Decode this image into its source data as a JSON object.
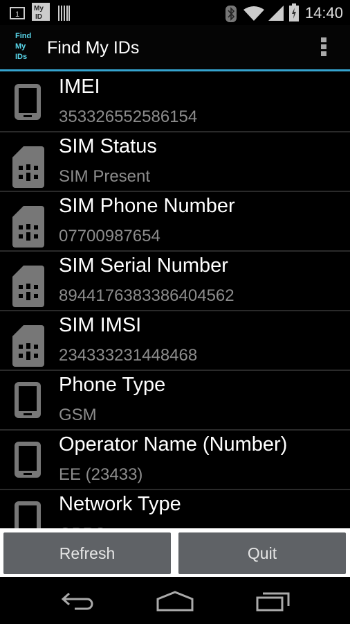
{
  "status_bar": {
    "time": "14:40",
    "notification_icons": [
      "sim-slot-1-icon",
      "my-id-app-icon",
      "barcode-icon"
    ],
    "system_icons": [
      "bluetooth-icon",
      "wifi-icon",
      "signal-icon",
      "battery-charging-icon"
    ],
    "my_id_badge": "My ID"
  },
  "action_bar": {
    "logo_lines": [
      "Find",
      "My",
      "IDs"
    ],
    "title": "Find My IDs",
    "overflow_icon": "overflow-menu-icon"
  },
  "colors": {
    "accent": "#35a4cf",
    "logo": "#5ad8ec",
    "button": "#5f6266"
  },
  "items": [
    {
      "label": "IMEI",
      "value": "353326552586154",
      "icon": "phone"
    },
    {
      "label": "SIM Status",
      "value": "SIM Present",
      "icon": "sim"
    },
    {
      "label": "SIM Phone Number",
      "value": "07700987654",
      "icon": "sim"
    },
    {
      "label": "SIM Serial Number",
      "value": "8944176383386404562",
      "icon": "sim"
    },
    {
      "label": "SIM IMSI",
      "value": "234333231448468",
      "icon": "sim"
    },
    {
      "label": "Phone Type",
      "value": "GSM",
      "icon": "phone"
    },
    {
      "label": "Operator Name (Number)",
      "value": "EE (23433)",
      "icon": "phone"
    },
    {
      "label": "Network Type",
      "value": "GPRS",
      "icon": "phone"
    }
  ],
  "buttons": {
    "refresh": "Refresh",
    "quit": "Quit"
  },
  "nav_bar": [
    "back-icon",
    "home-icon",
    "recents-icon"
  ]
}
